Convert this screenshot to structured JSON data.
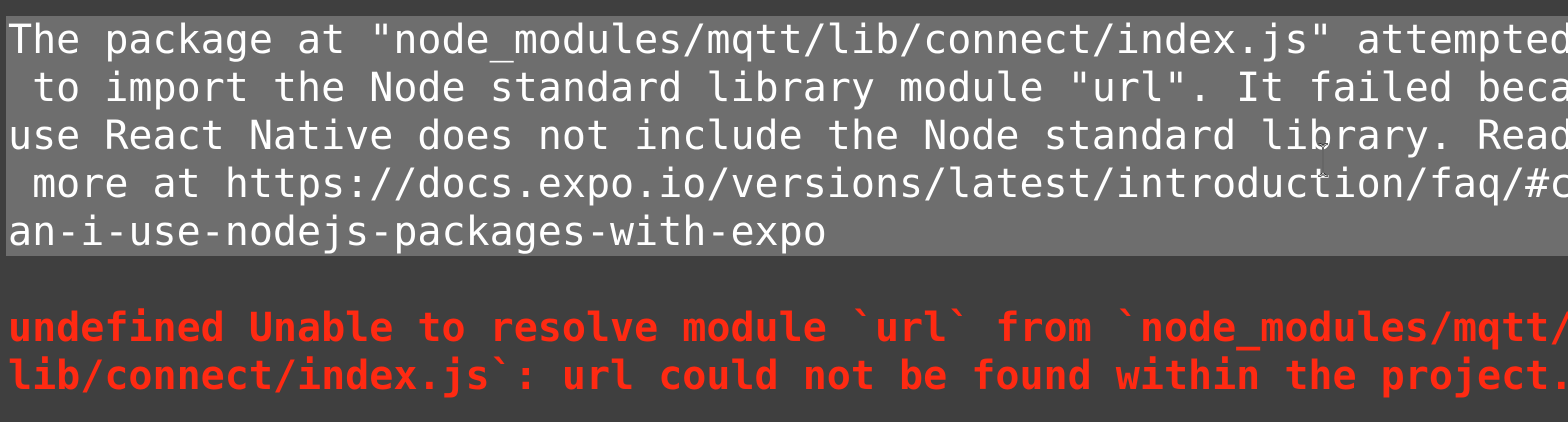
{
  "terminal": {
    "info_lines": [
      "The package at \"node_modules/mqtt/lib/connect/index.js\" attempted",
      " to import the Node standard library module \"url\". It failed beca",
      "use React Native does not include the Node standard library. Read",
      " more at https://docs.expo.io/versions/latest/introduction/faq/#c",
      "an-i-use-nodejs-packages-with-expo"
    ],
    "error_lines": [
      "undefined Unable to resolve module `url` from `node_modules/mqtt/",
      "lib/connect/index.js`: url could not be found within the project."
    ]
  },
  "colors": {
    "background": "#3f3f3f",
    "selection": "#6e6e6e",
    "info_text": "#ffffff",
    "error_text": "#ff2a12"
  },
  "icons": {
    "cursor": "text-cursor-icon"
  }
}
